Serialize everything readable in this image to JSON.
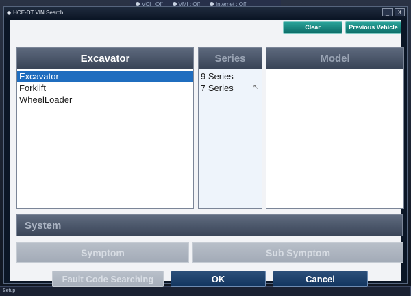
{
  "status_bar": {
    "vci": "VCI : Off",
    "vmi": "VMI : Off",
    "internet": "Internet : Off"
  },
  "window": {
    "title": "HCE-DT VIN Search",
    "minimize_icon": "minimize-icon",
    "close_icon": "close-icon",
    "minimize_glyph": "_",
    "close_glyph": "X"
  },
  "toolbar": {
    "clear_label": "Clear",
    "previous_vehicle_label": "Previous Vehicle"
  },
  "type_panel": {
    "header": "Excavator",
    "items": [
      "Excavator",
      "Forklift",
      "WheelLoader"
    ],
    "selected": "Excavator"
  },
  "series_panel": {
    "header": "Series",
    "items": [
      "9 Series",
      "7 Series"
    ]
  },
  "model_panel": {
    "header": "Model",
    "items": []
  },
  "system": {
    "label": "System"
  },
  "symptom": {
    "label": "Symptom"
  },
  "sub_symptom": {
    "label": "Sub Symptom"
  },
  "footer": {
    "fault_code_label": "Fault Code Searching",
    "ok_label": "OK",
    "cancel_label": "Cancel"
  },
  "bottom_bar": {
    "setup_label": "Setup"
  },
  "colors": {
    "selected_row": "#1f6dbf",
    "teal_button": "#0d6e69",
    "dark_button": "#12355f",
    "header_bar": "#384356"
  }
}
